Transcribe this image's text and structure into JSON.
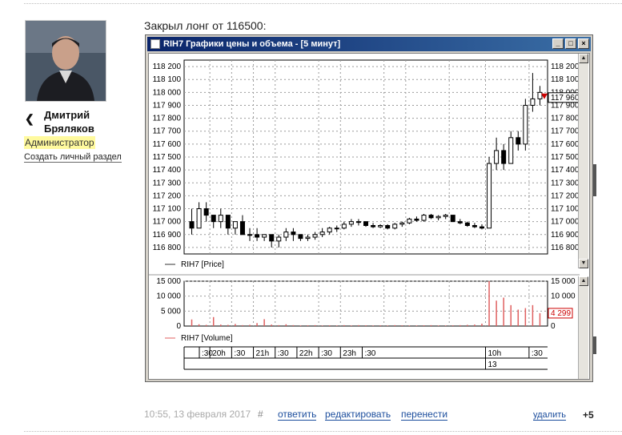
{
  "author": {
    "name_line1": "Дмитрий",
    "name_line2": "Бряляков",
    "role": "Администратор",
    "create_section_link": "Создать личный раздел"
  },
  "post": {
    "title": "Закрыл лонг от 116500:"
  },
  "window": {
    "title": "RIH7 Графики цены и объема - [5 минут]",
    "btn_minimize": "_",
    "btn_maximize": "□",
    "btn_close": "×"
  },
  "price_panel": {
    "legend": "RIH7 [Price]",
    "y_ticks": [
      "118 200",
      "118 100",
      "118 000",
      "117 900",
      "117 800",
      "117 700",
      "117 600",
      "117 500",
      "117 400",
      "117 300",
      "117 200",
      "117 100",
      "117 000",
      "116 900",
      "116 800"
    ],
    "y_ticks_right": [
      "118 200",
      "118 100",
      "118 000",
      "117 900",
      "117 800",
      "117 700",
      "117 600",
      "117 500",
      "117 400",
      "117 300",
      "117 200",
      "117 100",
      "117 000",
      "116 900",
      "116 800"
    ],
    "last_price_label": "117 960",
    "last_price_color": "#cc0000"
  },
  "volume_panel": {
    "legend": "RIH7 [Volume]",
    "y_ticks": [
      "15 000",
      "10 000",
      "5 000",
      "0"
    ],
    "y_ticks_right": [
      "15 000",
      "10 000",
      "5 000",
      "0"
    ],
    "last_volume_label": "4 299",
    "bar_color": "#e06060"
  },
  "time_axis": {
    "labels": [
      ":30",
      "20h",
      ":30",
      "21h",
      ":30",
      "22h",
      ":30",
      "23h",
      ":30",
      "10h",
      ":30"
    ],
    "date_label": "13"
  },
  "chart_data": {
    "type": "candlestick",
    "ylim": [
      116750,
      118250
    ],
    "candles": [
      [
        117000,
        117100,
        116900,
        116950
      ],
      [
        116950,
        117150,
        116950,
        117100
      ],
      [
        117100,
        117150,
        117000,
        117050
      ],
      [
        117050,
        117050,
        116950,
        117000
      ],
      [
        117000,
        117100,
        116950,
        117050
      ],
      [
        117050,
        117050,
        116900,
        116950
      ],
      [
        116950,
        117000,
        116900,
        117000
      ],
      [
        117000,
        117050,
        116900,
        116900
      ],
      [
        116900,
        116950,
        116850,
        116900
      ],
      [
        116900,
        116950,
        116850,
        116880
      ],
      [
        116880,
        116900,
        116850,
        116900
      ],
      [
        116900,
        116900,
        116800,
        116850
      ],
      [
        116850,
        116900,
        116800,
        116880
      ],
      [
        116880,
        116950,
        116850,
        116920
      ],
      [
        116920,
        116950,
        116850,
        116900
      ],
      [
        116900,
        116900,
        116850,
        116870
      ],
      [
        116870,
        116900,
        116850,
        116880
      ],
      [
        116880,
        116920,
        116860,
        116900
      ],
      [
        116900,
        116950,
        116880,
        116920
      ],
      [
        116920,
        116960,
        116900,
        116950
      ],
      [
        116950,
        116970,
        116920,
        116950
      ],
      [
        116950,
        117000,
        116940,
        116980
      ],
      [
        116980,
        117020,
        116960,
        117000
      ],
      [
        117000,
        117020,
        116970,
        117000
      ],
      [
        117000,
        117000,
        116960,
        116970
      ],
      [
        116970,
        116990,
        116950,
        116960
      ],
      [
        116960,
        116980,
        116950,
        116970
      ],
      [
        116970,
        116980,
        116940,
        116950
      ],
      [
        116950,
        116990,
        116940,
        116980
      ],
      [
        116980,
        117000,
        116960,
        116990
      ],
      [
        116990,
        117030,
        116980,
        117020
      ],
      [
        117020,
        117040,
        117000,
        117010
      ],
      [
        117010,
        117060,
        117000,
        117050
      ],
      [
        117050,
        117060,
        117020,
        117030
      ],
      [
        117030,
        117050,
        117010,
        117040
      ],
      [
        117040,
        117060,
        117020,
        117050
      ],
      [
        117050,
        117050,
        117000,
        117000
      ],
      [
        117000,
        117020,
        116980,
        116990
      ],
      [
        116990,
        117000,
        116960,
        116970
      ],
      [
        116970,
        116990,
        116950,
        116960
      ],
      [
        116960,
        116980,
        116940,
        116950
      ],
      [
        116950,
        117500,
        116950,
        117450
      ],
      [
        117450,
        117650,
        117400,
        117550
      ],
      [
        117550,
        117600,
        117400,
        117450
      ],
      [
        117450,
        117700,
        117450,
        117650
      ],
      [
        117650,
        117700,
        117550,
        117600
      ],
      [
        117600,
        117950,
        117550,
        117900
      ],
      [
        117900,
        118150,
        117850,
        117950
      ],
      [
        117950,
        118050,
        117900,
        118000
      ]
    ],
    "volumes": [
      2200,
      600,
      400,
      3000,
      500,
      400,
      700,
      300,
      400,
      1000,
      2300,
      500,
      300,
      600,
      300,
      200,
      250,
      300,
      200,
      250,
      200,
      300,
      200,
      300,
      250,
      200,
      250,
      200,
      300,
      250,
      200,
      200,
      250,
      300,
      200,
      200,
      250,
      300,
      400,
      500,
      800,
      15000,
      8500,
      9500,
      7000,
      5500,
      6000,
      7000,
      4300
    ],
    "xlabel": "",
    "ylabel": ""
  },
  "footer": {
    "timestamp": "10:55, 13 февраля 2017",
    "hash": "#",
    "reply": "ответить",
    "edit": "редактировать",
    "move": "перенести",
    "delete": "удалить",
    "score": "+5"
  }
}
